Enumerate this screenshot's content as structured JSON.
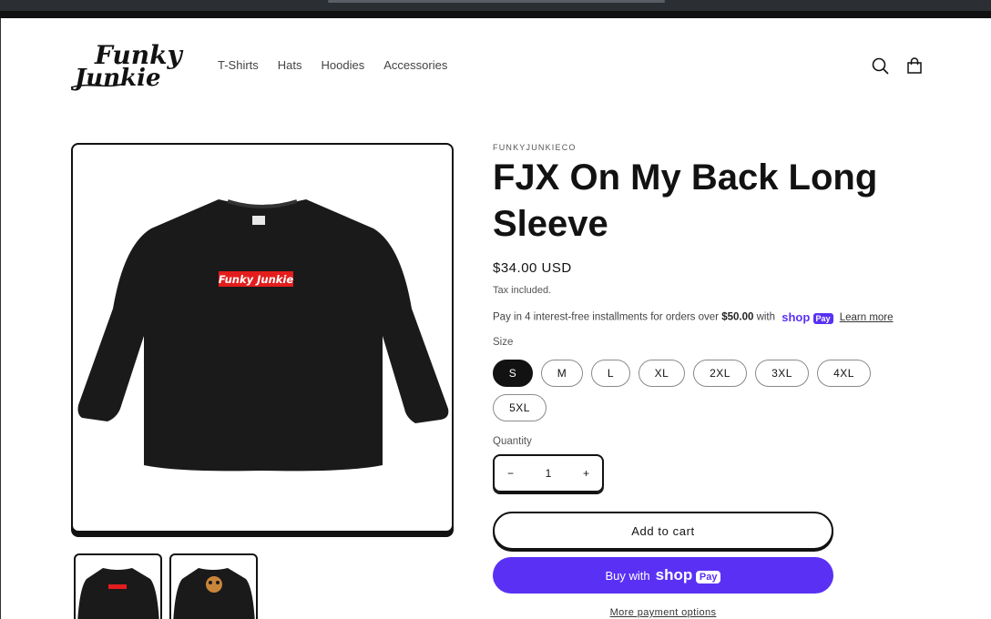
{
  "brand": {
    "logo_alt": "Funky Junkie"
  },
  "nav": {
    "items": [
      "T-Shirts",
      "Hats",
      "Hoodies",
      "Accessories"
    ]
  },
  "header_icons": {
    "search": "search-icon",
    "cart": "cart-icon"
  },
  "product": {
    "vendor": "FUNKYJUNKIECO",
    "title": "FJX On My Back Long Sleeve",
    "price": "$34.00 USD",
    "tax_note": "Tax included.",
    "installments": {
      "prefix": "Pay in 4 interest-free installments for orders over ",
      "amount": "$50.00",
      "suffix": " with",
      "shop_word": "shop",
      "pay_word": "Pay",
      "learn_more": "Learn more"
    },
    "print_text": "Funky Junkie",
    "size_label": "Size",
    "sizes": [
      "S",
      "M",
      "L",
      "XL",
      "2XL",
      "3XL",
      "4XL",
      "5XL"
    ],
    "selected_size": "S",
    "quantity_label": "Quantity",
    "quantity_value": "1",
    "qty_minus": "−",
    "qty_plus": "+",
    "add_to_cart": "Add to cart",
    "buy_with": "Buy with",
    "more_payment": "More payment options"
  },
  "colors": {
    "accent": "#5a31f4",
    "ink": "#121212",
    "print_red": "#e31d1d"
  }
}
